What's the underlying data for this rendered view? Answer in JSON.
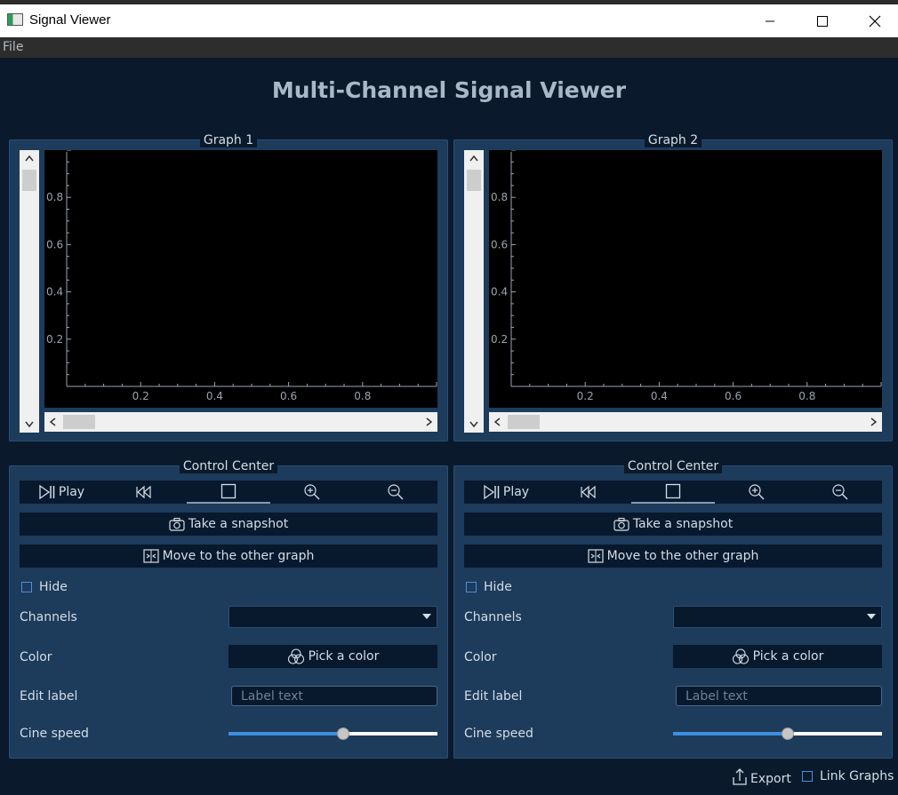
{
  "window": {
    "title": "Signal Viewer"
  },
  "menubar": {
    "file": "File"
  },
  "main": {
    "title": "Multi-Channel Signal Viewer"
  },
  "graphs": [
    {
      "title": "Graph 1",
      "x_ticks": [
        "0.2",
        "0.4",
        "0.6",
        "0.8"
      ],
      "y_ticks": [
        "0.8",
        "0.6",
        "0.4",
        "0.2"
      ]
    },
    {
      "title": "Graph 2",
      "x_ticks": [
        "0.2",
        "0.4",
        "0.6",
        "0.8"
      ],
      "y_ticks": [
        "0.8",
        "0.6",
        "0.4",
        "0.2"
      ]
    }
  ],
  "controls": [
    {
      "title": "Control Center",
      "play_label": "Play",
      "snapshot_label": "Take a snapshot",
      "move_label": "Move to the other graph",
      "hide_label": "Hide",
      "channels_label": "Channels",
      "channels_value": "",
      "color_label": "Color",
      "pick_color_label": "Pick a color",
      "edit_label": "Edit label",
      "label_placeholder": "Label text",
      "cine_label": "Cine speed",
      "cine_speed_fraction": 0.55
    },
    {
      "title": "Control Center",
      "play_label": "Play",
      "snapshot_label": "Take a snapshot",
      "move_label": "Move to the other graph",
      "hide_label": "Hide",
      "channels_label": "Channels",
      "channels_value": "",
      "color_label": "Color",
      "pick_color_label": "Pick a color",
      "edit_label": "Edit label",
      "label_placeholder": "Label text",
      "cine_label": "Cine speed",
      "cine_speed_fraction": 0.55
    }
  ],
  "footer": {
    "export_label": "Export",
    "link_label": "Link Graphs"
  },
  "colors": {
    "background": "#0a1a2c",
    "panel": "#1d3b5b",
    "button": "#08192e",
    "accent": "#3d8fde",
    "title": "#a9b8c8"
  },
  "icons": [
    "app-icon",
    "minimize-icon",
    "maximize-icon",
    "close-icon",
    "play-pause-icon",
    "rewind-icon",
    "stop-icon",
    "zoom-in-icon",
    "zoom-out-icon",
    "camera-icon",
    "swap-icon",
    "color-wheel-icon",
    "export-icon"
  ]
}
